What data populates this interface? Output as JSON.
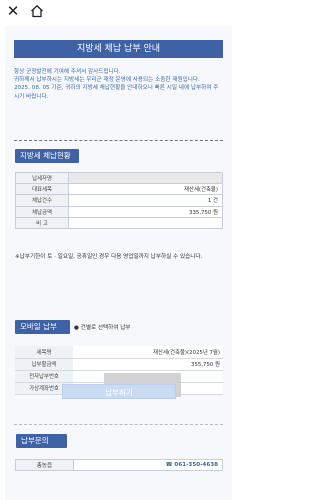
{
  "topbar": {
    "close_icon": "close-icon",
    "home_icon": "home-icon"
  },
  "title": "지방세 체납 납부 안내",
  "intro": {
    "line1": "항상 군정발전에 기여해 주셔서 감사드립니다.",
    "line2": "귀하께서 납부하시는 지방세는 우리군 재정 운영에 사용되는 소중한 재원입니다.",
    "line3": "2025. 08. 05 기준, 귀하의 지방세 체납현황을 안내하오니 빠른 시일 내에 납부하여 주시기 바랍니다."
  },
  "status_section": {
    "heading": "지방세 체납현황",
    "rows": [
      {
        "label": "납세자명",
        "value": ""
      },
      {
        "label": "대표세목",
        "value": "재산세(건축물)"
      },
      {
        "label": "체납건수",
        "value": "1 건"
      },
      {
        "label": "체납금액",
        "value": "335,750 원"
      },
      {
        "label": "비 고",
        "value": ""
      }
    ],
    "note": "※납부기한이 토 · 일요일, 공휴일인 경우 다음 영업일까지 납부하실 수 있습니다."
  },
  "mobile_section": {
    "heading": "모바일 납부",
    "sub_note": "건별로 선택하여 납부",
    "rows": [
      {
        "label": "세목명",
        "value": "재산세(건축물)(2025년 7월)"
      },
      {
        "label": "납부할금액",
        "value": "355,750 원"
      },
      {
        "label": "전자납부번호",
        "value": ""
      },
      {
        "label": "가상계좌번호",
        "value": ""
      }
    ],
    "pay_button": "납부하기"
  },
  "inquiry_section": {
    "heading": "납부문의",
    "label": "총농읍",
    "phone": "☎ 061-350-4638"
  },
  "colors": {
    "accent": "#3f62a7",
    "intro_text": "#3b65a8",
    "button_bg": "#c9dcf3"
  }
}
